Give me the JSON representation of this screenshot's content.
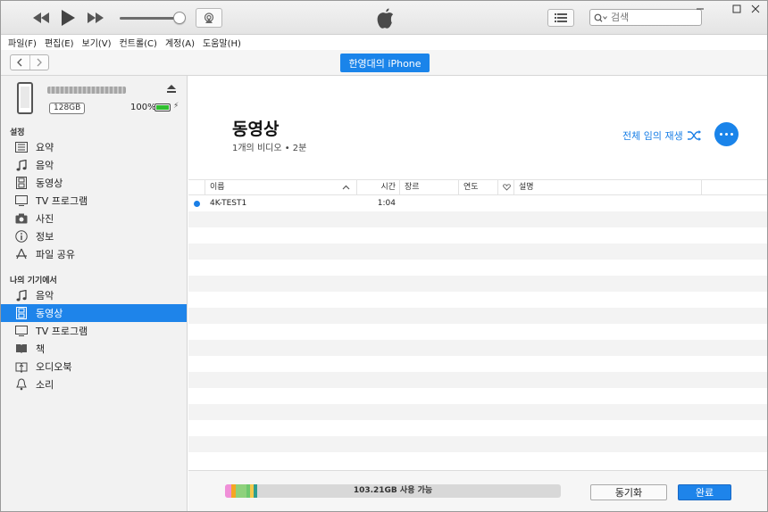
{
  "toolbar": {
    "search_placeholder": "검색",
    "window_controls": [
      "minimize-icon",
      "maximize-icon",
      "close-icon"
    ]
  },
  "menu": [
    "파일(F)",
    "편집(E)",
    "보기(V)",
    "컨트롤(C)",
    "계정(A)",
    "도움말(H)"
  ],
  "nav": {
    "device_button": "한영대의 iPhone"
  },
  "device": {
    "capacity": "128GB",
    "battery": "100%",
    "battery_level": 1.0
  },
  "sidebar": {
    "settings_title": "설정",
    "settings_items": [
      {
        "label": "요약",
        "icon": "summary-icon"
      },
      {
        "label": "음악",
        "icon": "music-note-icon"
      },
      {
        "label": "동영상",
        "icon": "film-icon"
      },
      {
        "label": "TV 프로그램",
        "icon": "tv-icon"
      },
      {
        "label": "사진",
        "icon": "camera-icon"
      },
      {
        "label": "정보",
        "icon": "info-icon"
      },
      {
        "label": "파일 공유",
        "icon": "app-store-icon"
      }
    ],
    "device_title": "나의 기기에서",
    "device_items": [
      {
        "label": "음악",
        "icon": "music-note-icon"
      },
      {
        "label": "동영상",
        "icon": "film-icon",
        "active": true
      },
      {
        "label": "TV 프로그램",
        "icon": "tv-icon"
      },
      {
        "label": "책",
        "icon": "book-icon"
      },
      {
        "label": "오디오북",
        "icon": "audiobook-icon"
      },
      {
        "label": "소리",
        "icon": "bell-icon"
      }
    ]
  },
  "main": {
    "title": "동영상",
    "subtitle": "1개의 비디오 • 2분",
    "shuffle_label": "전체 임의 재생",
    "columns": {
      "name": "이름",
      "time": "시간",
      "genre": "장르",
      "year": "연도",
      "description": "설명"
    },
    "rows": [
      {
        "name": "4K-TEST1",
        "time": "1:04",
        "genre": "",
        "year": "",
        "description": ""
      }
    ]
  },
  "footer": {
    "storage_label": "103.21GB 사용 가능",
    "sync_label": "동기화",
    "done_label": "완료",
    "storage_colors": [
      "#f08fd8",
      "#f5a623",
      "#8fd17c",
      "#6ec86e",
      "#f2c94c",
      "#2f9e8f"
    ]
  },
  "colors": {
    "accent": "#1e84ea"
  }
}
